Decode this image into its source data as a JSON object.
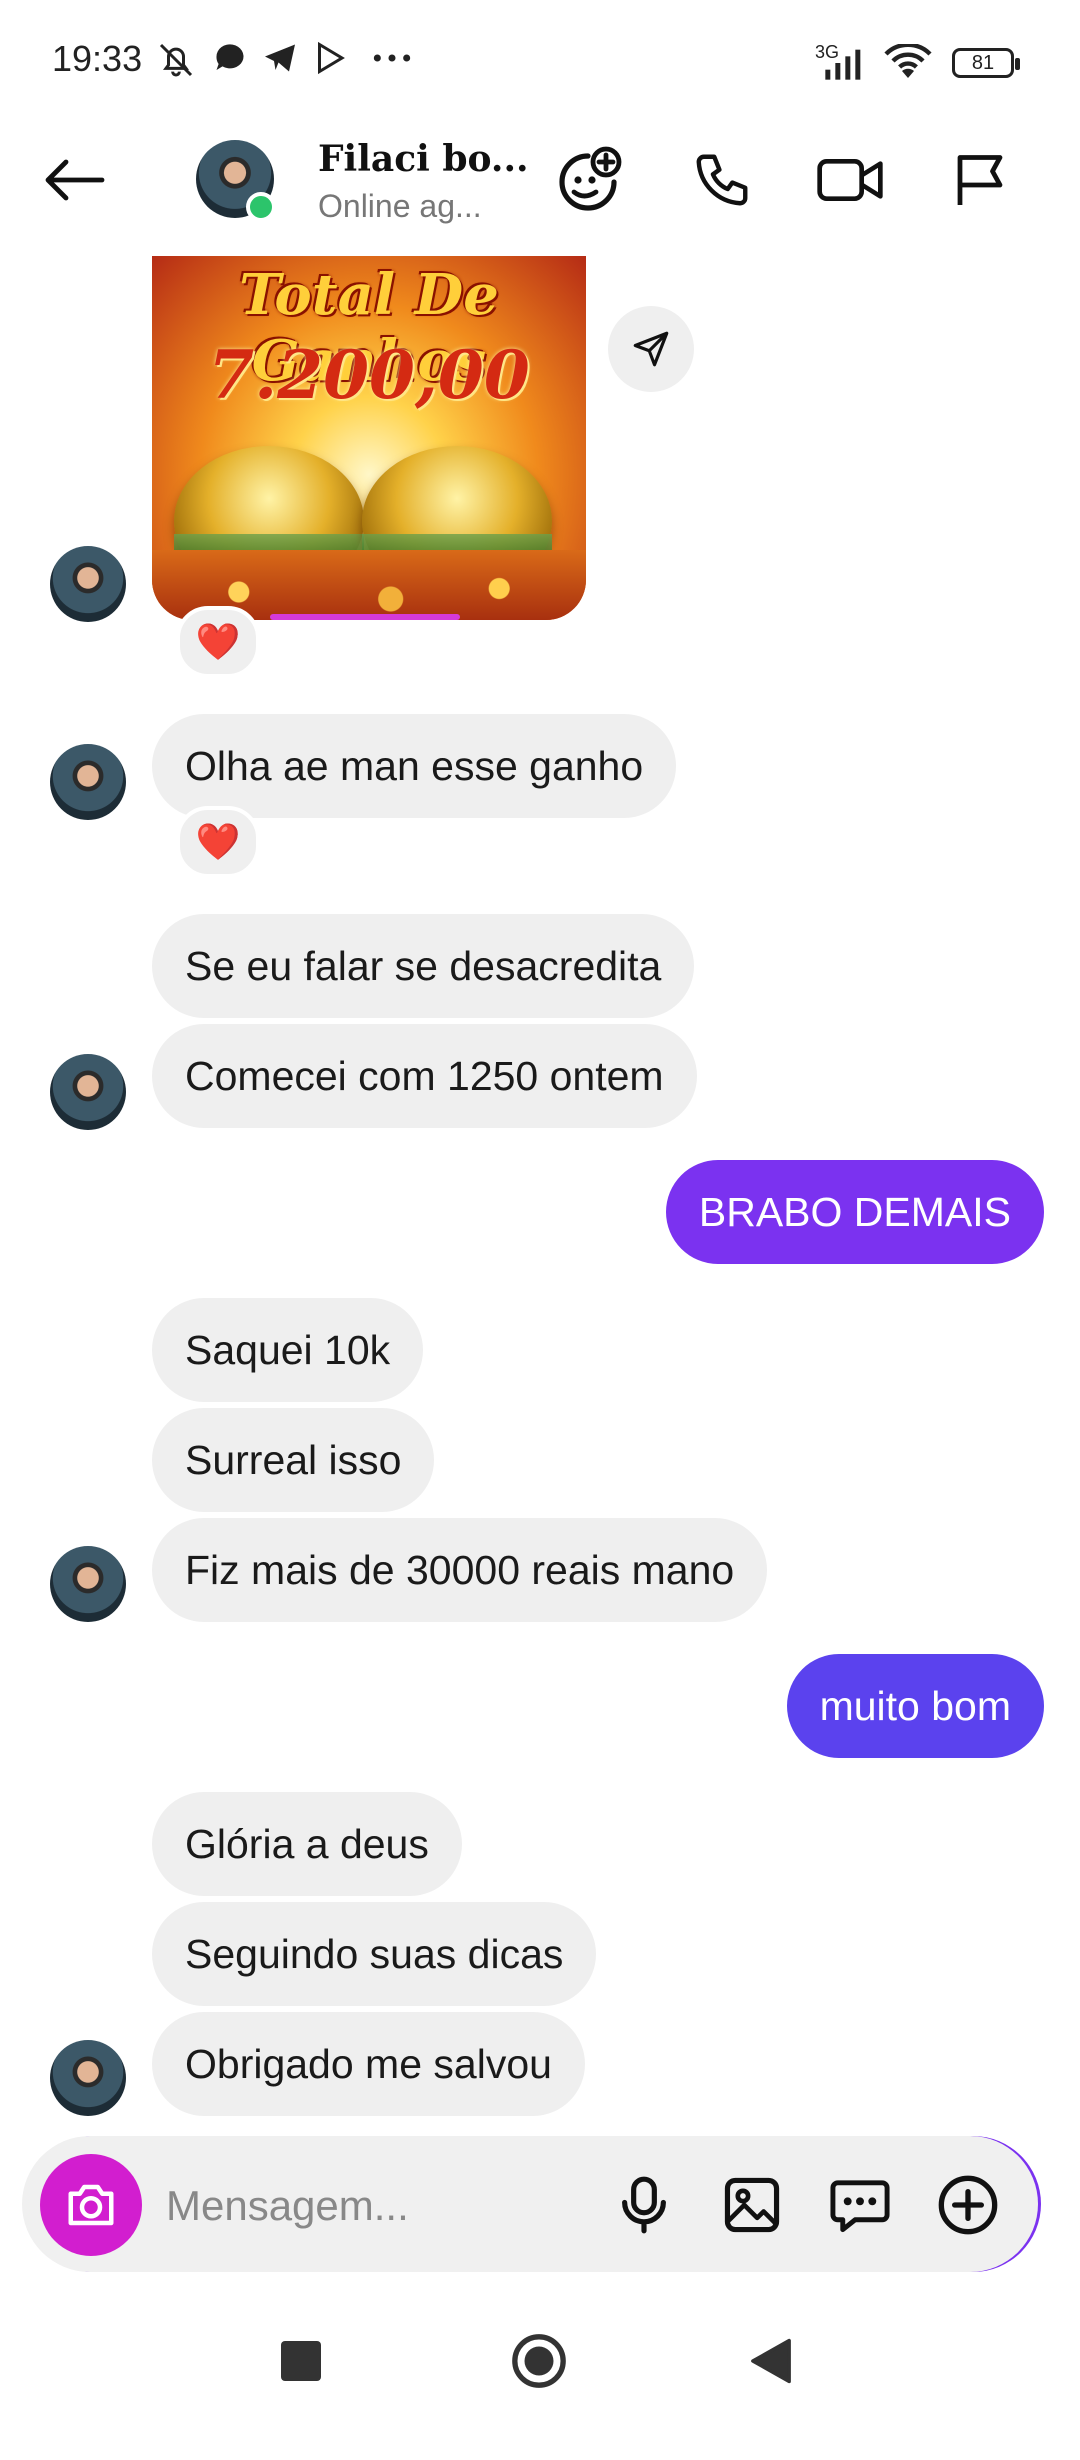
{
  "status_bar": {
    "time": "19:33",
    "network": "3G",
    "battery": "81",
    "icons": [
      "muted-bell-icon",
      "chat-bubble-icon",
      "telegram-icon",
      "play-icon",
      "more-dots-icon",
      "signal-icon",
      "wifi-icon",
      "battery-icon"
    ]
  },
  "header": {
    "back_icon": "arrow-left-icon",
    "name": "Filaci bo...",
    "status": "Online ag...",
    "actions": [
      "sticker-add-icon",
      "phone-icon",
      "video-icon",
      "flag-icon"
    ]
  },
  "image_message": {
    "title": "Total De Ganhos",
    "amount": "7.200,00",
    "reaction": "❤️"
  },
  "messages": [
    {
      "direction": "in",
      "text": "Olha ae man esse ganho",
      "reaction": "❤️"
    },
    {
      "direction": "in",
      "text": "Se eu falar se desacredita"
    },
    {
      "direction": "in",
      "text": "Comecei com 1250 ontem"
    },
    {
      "direction": "out",
      "text": "BRABO DEMAIS"
    },
    {
      "direction": "in",
      "text": "Saquei 10k"
    },
    {
      "direction": "in",
      "text": "Surreal isso"
    },
    {
      "direction": "in",
      "text": "Fiz mais de 30000 reais mano"
    },
    {
      "direction": "out",
      "text": "muito bom"
    },
    {
      "direction": "in",
      "text": "Glória a deus"
    },
    {
      "direction": "in",
      "text": "Seguindo suas dicas"
    },
    {
      "direction": "in",
      "text": "Obrigado me salvou"
    }
  ],
  "composer": {
    "placeholder": "Mensagem...",
    "buttons": [
      "camera-icon",
      "microphone-icon",
      "gallery-icon",
      "sticker-chat-icon",
      "add-circle-icon"
    ]
  },
  "colors": {
    "accent_out_bubble": "#7b32f0",
    "incoming_bubble": "#efefef",
    "camera_button": "#d21ecf",
    "online": "#2cc46b"
  }
}
